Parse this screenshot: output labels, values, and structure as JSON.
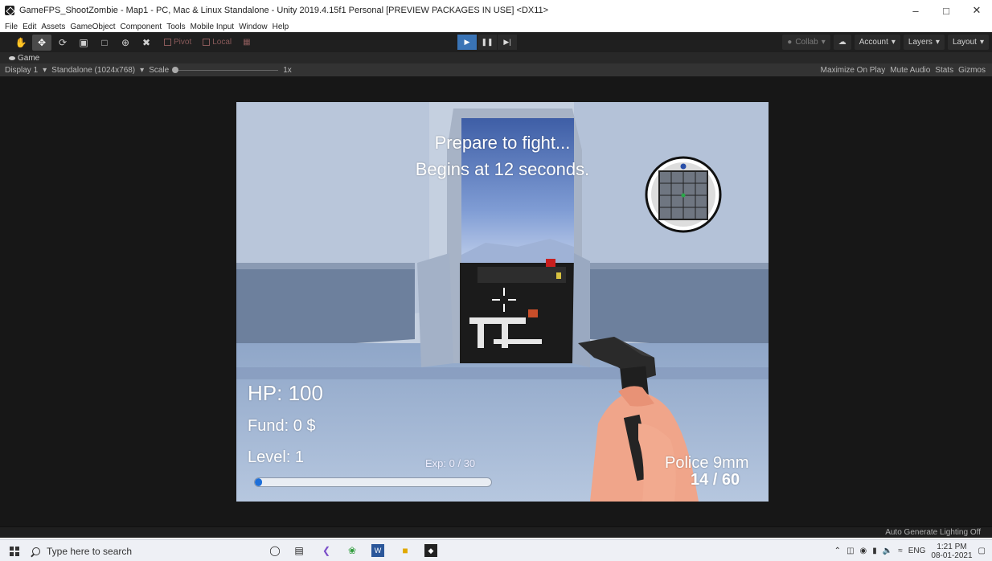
{
  "window": {
    "title": "GameFPS_ShootZombie - Map1 - PC, Mac & Linux Standalone - Unity 2019.4.15f1 Personal [PREVIEW PACKAGES IN USE] <DX11>"
  },
  "menu": [
    "File",
    "Edit",
    "Assets",
    "GameObject",
    "Component",
    "Tools",
    "Mobile Input",
    "Window",
    "Help"
  ],
  "toolbar": {
    "pivot_label": "Pivot",
    "local_label": "Local",
    "collab_label": "Collab",
    "account_label": "Account",
    "layers_label": "Layers",
    "layout_label": "Layout"
  },
  "game_tab": {
    "label": "Game"
  },
  "game_bar": {
    "display": "Display 1",
    "resolution": "Standalone (1024x768)",
    "scale_label": "Scale",
    "scale_value": "1x",
    "maximize_on_play": "Maximize On Play",
    "mute_audio": "Mute Audio",
    "stats": "Stats",
    "gizmos": "Gizmos"
  },
  "hud": {
    "prepare_line1": "Prepare to fight...",
    "prepare_line2": "Begins at 12 seconds.",
    "hp": "HP: 100",
    "fund": "Fund: 0 $",
    "level": "Level: 1",
    "exp": "Exp: 0 / 30",
    "exp_progress": 0.03,
    "weapon": "Police 9mm",
    "ammo": "14 / 60"
  },
  "status_bar": {
    "text": "Auto Generate Lighting Off"
  },
  "taskbar": {
    "search_placeholder": "Type here to search",
    "language": "ENG",
    "time": "1:21 PM",
    "date": "08-01-2021"
  }
}
